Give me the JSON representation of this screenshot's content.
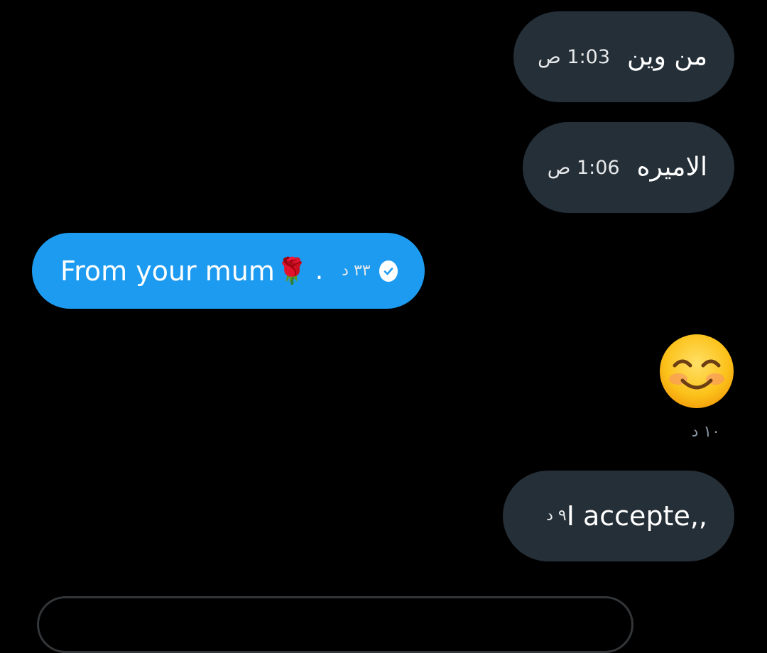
{
  "messages": [
    {
      "id": "m1",
      "direction": "received",
      "text": "من وين",
      "time": "1:03 ص"
    },
    {
      "id": "m2",
      "direction": "received",
      "text": "الاميره",
      "time": "1:06 ص"
    },
    {
      "id": "m3",
      "direction": "sent",
      "text": "From your mum",
      "emoji": "🌹",
      "trailing": ".",
      "time": "٣٣ د",
      "status_icon": "seen-check-icon"
    },
    {
      "id": "m4",
      "direction": "received",
      "emoji": "smiling-face-with-smiling-eyes",
      "time": "١٠ د"
    },
    {
      "id": "m5",
      "direction": "received",
      "text": "I accepte,,",
      "time": "٩ د"
    }
  ],
  "colors": {
    "background": "#000000",
    "received_bubble": "#252f38",
    "sent_bubble": "#1d9bf0",
    "text": "#ffffff",
    "muted_time": "#8b98a5"
  }
}
